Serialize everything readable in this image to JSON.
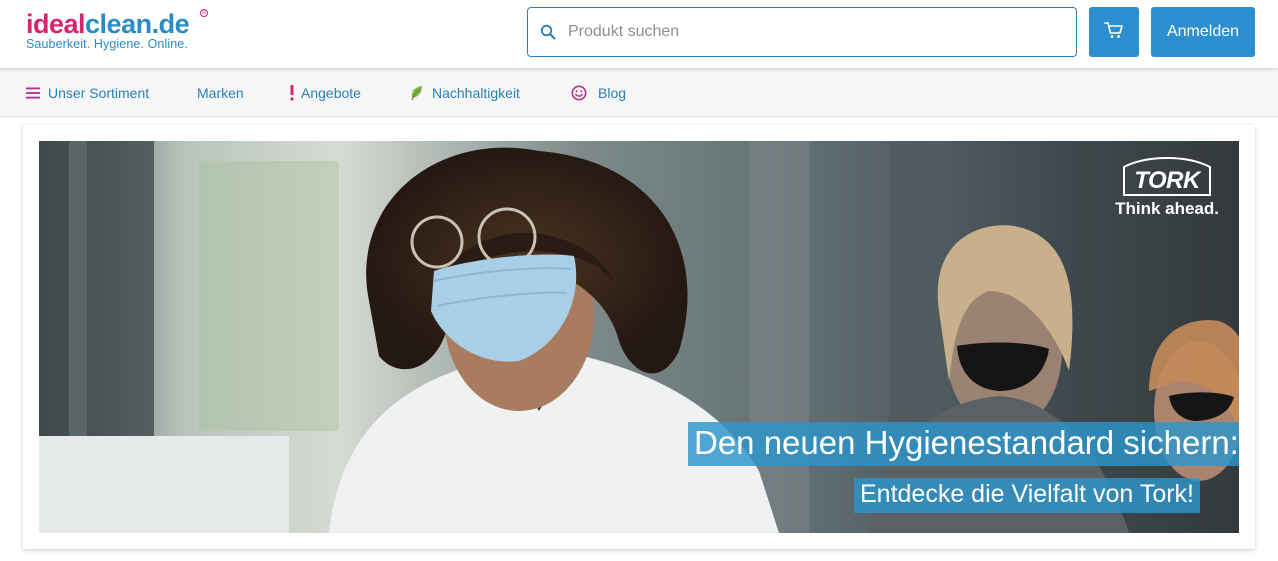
{
  "header": {
    "logo": {
      "name_part1": "ideal",
      "name_part2": "clean.de",
      "registered": "R",
      "tagline": "Sauberkeit. Hygiene. Online."
    },
    "search": {
      "placeholder": "Produkt suchen",
      "icon": "search-icon"
    },
    "cart": {
      "icon": "cart-icon"
    },
    "login_label": "Anmelden"
  },
  "nav": {
    "items": [
      {
        "label": "Unser Sortiment",
        "icon": "menu-icon"
      },
      {
        "label": "Marken"
      },
      {
        "label": "Angebote",
        "icon": "exclamation-icon"
      },
      {
        "label": "Nachhaltigkeit",
        "icon": "leaf-icon"
      },
      {
        "label": "Blog",
        "icon": "smiley-icon"
      }
    ]
  },
  "banner": {
    "brand_logo": "TORK",
    "brand_tagline": "Think ahead.",
    "headline": "Den neuen Hygienestandard sichern:",
    "subheadline": "Entdecke die Vielfalt von Tork!"
  },
  "colors": {
    "brand_pink": "#d6246e",
    "brand_blue": "#2a8bc6",
    "button_blue": "#2c8fcf",
    "nav_background": "#f6f6f7",
    "banner_caption": "#2c95cb"
  }
}
